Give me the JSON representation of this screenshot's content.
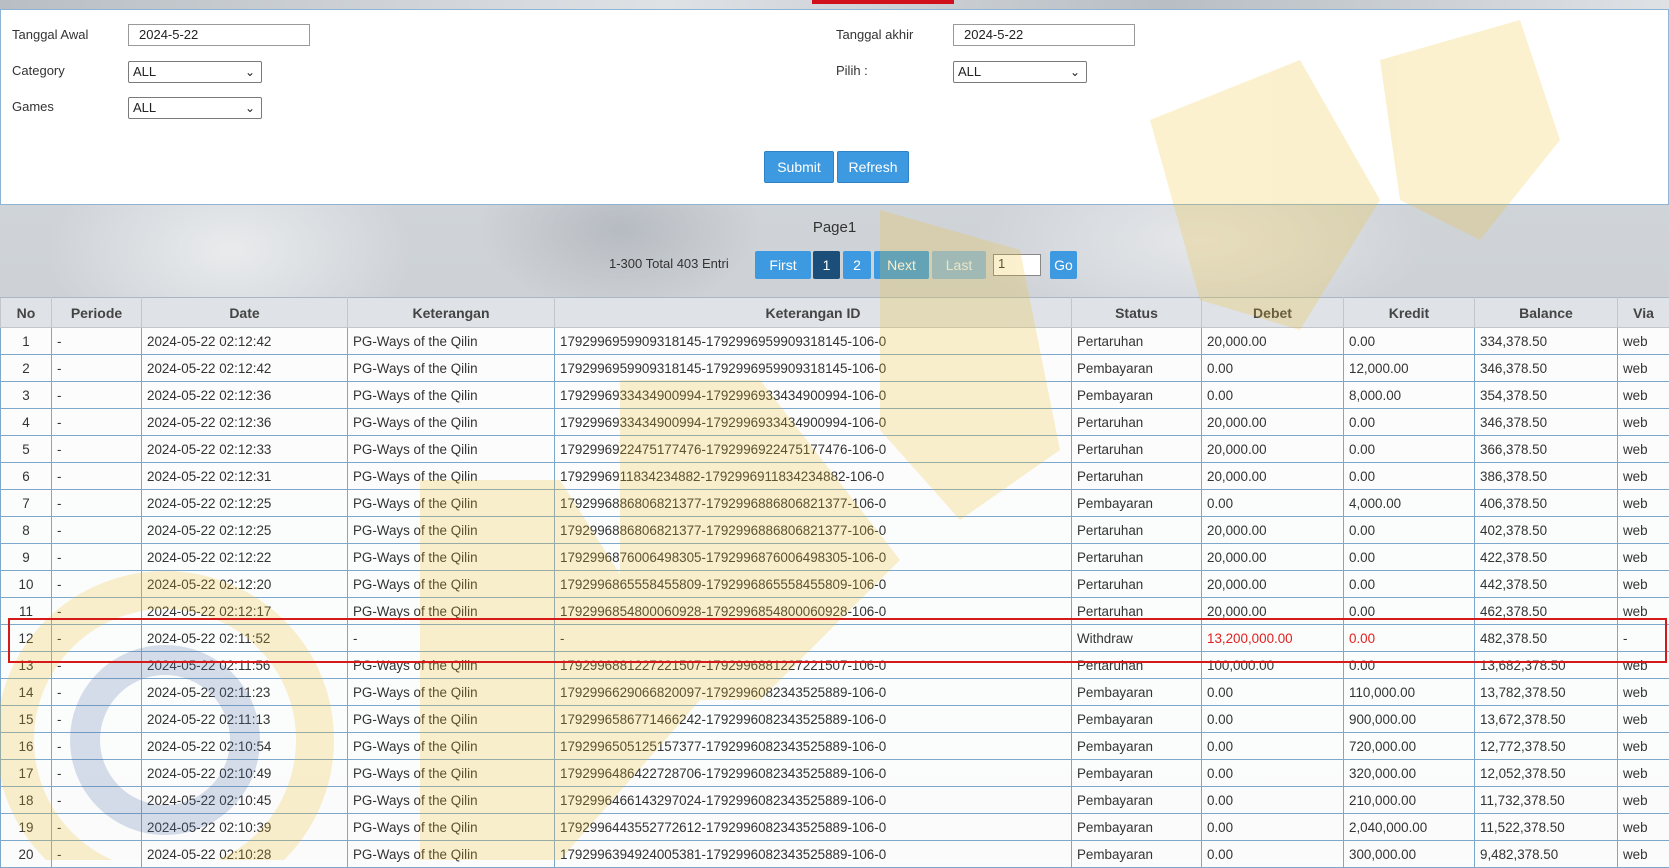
{
  "filters": {
    "start_label": "Tanggal Awal",
    "start_value": "2024-5-22",
    "end_label": "Tanggal akhir",
    "end_value": "2024-5-22",
    "category_label": "Category",
    "category_value": "ALL",
    "pilih_label": "Pilih :",
    "pilih_value": "ALL",
    "games_label": "Games",
    "games_value": "ALL",
    "submit_label": "Submit",
    "refresh_label": "Refresh"
  },
  "pagination": {
    "page_title": "Page1",
    "range_text": "1-300 Total 403 Entri",
    "first": "First",
    "page1": "1",
    "page2": "2",
    "next": "Next",
    "last": "Last",
    "page_input": "1",
    "go": "Go"
  },
  "table": {
    "headers": [
      "No",
      "Periode",
      "Date",
      "Keterangan",
      "Keterangan ID",
      "Status",
      "Debet",
      "Kredit",
      "Balance",
      "Via"
    ],
    "rows": [
      [
        "1",
        "-",
        "2024-05-22 02:12:42",
        "PG-Ways of the Qilin",
        "1792996959909318145-1792996959909318145-106-0",
        "Pertaruhan",
        "20,000.00",
        "0.00",
        "334,378.50",
        "web"
      ],
      [
        "2",
        "-",
        "2024-05-22 02:12:42",
        "PG-Ways of the Qilin",
        "1792996959909318145-1792996959909318145-106-0",
        "Pembayaran",
        "0.00",
        "12,000.00",
        "346,378.50",
        "web"
      ],
      [
        "3",
        "-",
        "2024-05-22 02:12:36",
        "PG-Ways of the Qilin",
        "1792996933434900994-1792996933434900994-106-0",
        "Pembayaran",
        "0.00",
        "8,000.00",
        "354,378.50",
        "web"
      ],
      [
        "4",
        "-",
        "2024-05-22 02:12:36",
        "PG-Ways of the Qilin",
        "1792996933434900994-1792996933434900994-106-0",
        "Pertaruhan",
        "20,000.00",
        "0.00",
        "346,378.50",
        "web"
      ],
      [
        "5",
        "-",
        "2024-05-22 02:12:33",
        "PG-Ways of the Qilin",
        "1792996922475177476-1792996922475177476-106-0",
        "Pertaruhan",
        "20,000.00",
        "0.00",
        "366,378.50",
        "web"
      ],
      [
        "6",
        "-",
        "2024-05-22 02:12:31",
        "PG-Ways of the Qilin",
        "1792996911834234882-1792996911834234882-106-0",
        "Pertaruhan",
        "20,000.00",
        "0.00",
        "386,378.50",
        "web"
      ],
      [
        "7",
        "-",
        "2024-05-22 02:12:25",
        "PG-Ways of the Qilin",
        "1792996886806821377-1792996886806821377-106-0",
        "Pembayaran",
        "0.00",
        "4,000.00",
        "406,378.50",
        "web"
      ],
      [
        "8",
        "-",
        "2024-05-22 02:12:25",
        "PG-Ways of the Qilin",
        "1792996886806821377-1792996886806821377-106-0",
        "Pertaruhan",
        "20,000.00",
        "0.00",
        "402,378.50",
        "web"
      ],
      [
        "9",
        "-",
        "2024-05-22 02:12:22",
        "PG-Ways of the Qilin",
        "1792996876006498305-1792996876006498305-106-0",
        "Pertaruhan",
        "20,000.00",
        "0.00",
        "422,378.50",
        "web"
      ],
      [
        "10",
        "-",
        "2024-05-22 02:12:20",
        "PG-Ways of the Qilin",
        "1792996865558455809-1792996865558455809-106-0",
        "Pertaruhan",
        "20,000.00",
        "0.00",
        "442,378.50",
        "web"
      ],
      [
        "11",
        "-",
        "2024-05-22 02:12:17",
        "PG-Ways of the Qilin",
        "1792996854800060928-1792996854800060928-106-0",
        "Pertaruhan",
        "20,000.00",
        "0.00",
        "462,378.50",
        "web"
      ],
      [
        "12",
        "-",
        "2024-05-22 02:11:52",
        "-",
        "-",
        "Withdraw",
        "13,200,000.00",
        "0.00",
        "482,378.50",
        "-"
      ],
      [
        "13",
        "-",
        "2024-05-22 02:11:56",
        "PG-Ways of the Qilin",
        "1792996881227221507-1792996881227221507-106-0",
        "Pertaruhan",
        "100,000.00",
        "0.00",
        "13,682,378.50",
        "web"
      ],
      [
        "14",
        "-",
        "2024-05-22 02:11:23",
        "PG-Ways of the Qilin",
        "1792996629066820097-1792996082343525889-106-0",
        "Pembayaran",
        "0.00",
        "110,000.00",
        "13,782,378.50",
        "web"
      ],
      [
        "15",
        "-",
        "2024-05-22 02:11:13",
        "PG-Ways of the Qilin",
        "1792996586771466242-1792996082343525889-106-0",
        "Pembayaran",
        "0.00",
        "900,000.00",
        "13,672,378.50",
        "web"
      ],
      [
        "16",
        "-",
        "2024-05-22 02:10:54",
        "PG-Ways of the Qilin",
        "1792996505125157377-1792996082343525889-106-0",
        "Pembayaran",
        "0.00",
        "720,000.00",
        "12,772,378.50",
        "web"
      ],
      [
        "17",
        "-",
        "2024-05-22 02:10:49",
        "PG-Ways of the Qilin",
        "1792996486422728706-1792996082343525889-106-0",
        "Pembayaran",
        "0.00",
        "320,000.00",
        "12,052,378.50",
        "web"
      ],
      [
        "18",
        "-",
        "2024-05-22 02:10:45",
        "PG-Ways of the Qilin",
        "1792996466143297024-1792996082343525889-106-0",
        "Pembayaran",
        "0.00",
        "210,000.00",
        "11,732,378.50",
        "web"
      ],
      [
        "19",
        "-",
        "2024-05-22 02:10:39",
        "PG-Ways of the Qilin",
        "1792996443552772612-1792996082343525889-106-0",
        "Pembayaran",
        "0.00",
        "2,040,000.00",
        "11,522,378.50",
        "web"
      ],
      [
        "20",
        "-",
        "2024-05-22 02:10:28",
        "PG-Ways of the Qilin",
        "1792996394924005381-1792996082343525889-106-0",
        "Pembayaran",
        "0.00",
        "300,000.00",
        "9,482,378.50",
        "web"
      ]
    ],
    "highlight_row_index": 11
  },
  "colors": {
    "accent_blue": "#3d9ae0",
    "active_page": "#1b4e78",
    "highlight_red": "#d61a1a"
  }
}
